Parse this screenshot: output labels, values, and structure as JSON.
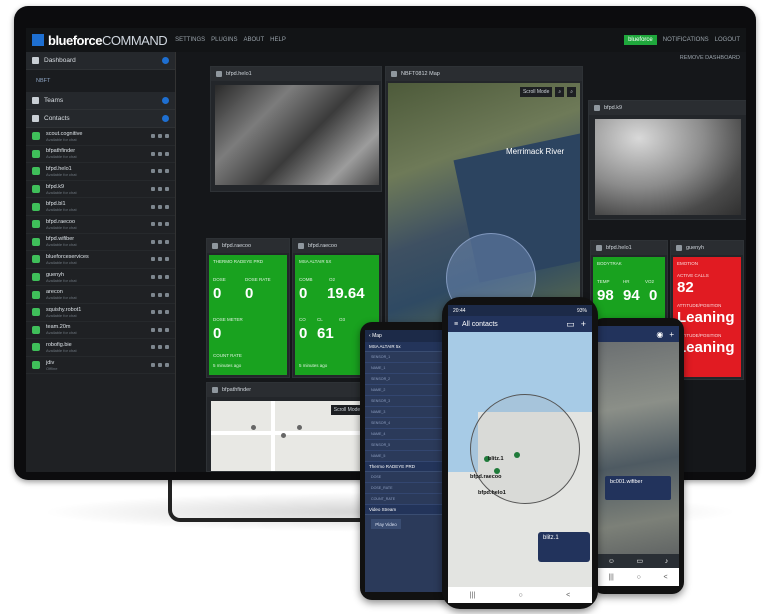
{
  "desktop": {
    "brand_bold": "blueforce",
    "brand_thin": "COMMAND",
    "nav": [
      "SETTINGS",
      "PLUGINS",
      "ABOUT",
      "HELP"
    ],
    "user": "blueforce",
    "right_nav": [
      "NOTIFICATIONS",
      "LOGOUT"
    ],
    "remove_dashboard": "REMOVE DASHBOARD",
    "sidebar": {
      "dashboard": "Dashboard",
      "dashboard_sub": "NBFT",
      "teams": "Teams",
      "contacts": "Contacts",
      "contact_list": [
        {
          "name": "scout.cognitive",
          "status": "Available for chat"
        },
        {
          "name": "bfpathfinder",
          "status": "Available for chat"
        },
        {
          "name": "bfpd.helo1",
          "status": "Available for chat"
        },
        {
          "name": "bfpd.k9",
          "status": "Available for chat"
        },
        {
          "name": "bfpd.bl1",
          "status": "Available for chat"
        },
        {
          "name": "bfpd.raecoo",
          "status": "Available for chat"
        },
        {
          "name": "bfpd.wifiber",
          "status": "Available for chat"
        },
        {
          "name": "blueforceservices",
          "status": "Available for chat"
        },
        {
          "name": "guenyh",
          "status": "Available for chat"
        },
        {
          "name": "arecon",
          "status": "Available for chat"
        },
        {
          "name": "squishy.robot1",
          "status": "Available for chat"
        },
        {
          "name": "team.20m",
          "status": "Available for chat"
        },
        {
          "name": "robofig.bie",
          "status": "Available for chat"
        },
        {
          "name": "jdiv",
          "status": "Offline"
        }
      ]
    },
    "panels": {
      "video1_title": "bfpd.helo1",
      "map_title": "NBFT0812 Map",
      "map_river": "Merrimack River",
      "map_tool": "Scroll Mode",
      "video2_title": "bfpd.k9",
      "raecoo1_title": "bfpd.raecoo",
      "raecoo2_title": "bfpd.raecoo",
      "helo1_title": "bfpd.helo1",
      "guenyh_title": "guenyh",
      "pathfinder_title": "bfpathfinder",
      "map2_tool": "Scroll Mode",
      "tile_thermo": {
        "caption": "THERMO RADEYE PRD",
        "dose": "0",
        "dose_rate": "0",
        "dose_meter": "0",
        "dose_label": "DOSE",
        "dose_rate_label": "DOSE RATE",
        "meter_label": "DOSE METER",
        "count_rate": "COUNT RATE",
        "ago": "5 minutes ago"
      },
      "tile_msa": {
        "caption": "MSA ALTAIR 5X",
        "comb": "0",
        "o2": "19.64",
        "co": "0",
        "h2s": "61",
        "cl": "0",
        "comb_label": "COMB",
        "o2_label": "O2",
        "co_label": "CO",
        "h2s_label": "CL",
        "cl_label": "O3",
        "ago": "5 minutes ago"
      },
      "tile_helo": {
        "caption": "BODYTRAK",
        "temp": "98",
        "hr": "94",
        "vo2": "0",
        "temp_label": "TEMP",
        "hr_label": "HR",
        "vo2_label": "VO2",
        "ago": "5 minutes ago"
      },
      "tile_guenyh": {
        "caption": "EMOTION",
        "active_calls": "82",
        "active_label": "ACTIVE CALLS",
        "attitude_label": "ATTITUDE/POSITION",
        "attitude": "Leaning",
        "attitude2_label": "ATTITUDE/POSITION",
        "attitude2": "Leaning",
        "ago": "5 minutes ago"
      }
    }
  },
  "phone_left": {
    "header": "Map",
    "section1": "MSA ALTAIR 5x",
    "sensors": [
      "SENSOR_1",
      "NAME_1",
      "SENSOR_2",
      "NAME_2",
      "SENSOR_3",
      "NAME_3",
      "SENSOR_4",
      "NAME_4",
      "SENSOR_5",
      "NAME_5"
    ],
    "section2": "Thermo RADEYE PRD",
    "thermo_rows": [
      "DOSE",
      "DOSE_RATE",
      "COUNT_RATE"
    ],
    "section3": "Video Stream",
    "play": "Play Video"
  },
  "phone_center": {
    "time": "20:44",
    "battery": "93%",
    "title": "All contacts",
    "label_helo": "bfpd.helo1",
    "label_raecoo": "bfpd.raecoo",
    "label_blitz": "blitz.1",
    "popup": "blitz.1",
    "nav": [
      "|||",
      "○",
      "<"
    ]
  },
  "phone_right": {
    "popup": "bc001.wifiber",
    "nav": [
      "|||",
      "○",
      "<"
    ]
  },
  "colors": {
    "accent": "#1e6fd1",
    "green": "#19a21f",
    "red": "#e11b22",
    "navy": "#22335c"
  }
}
